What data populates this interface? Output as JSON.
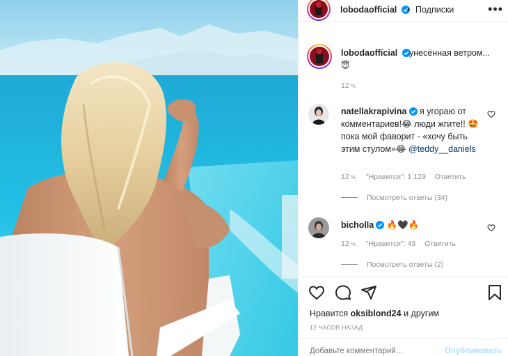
{
  "post": {
    "author": "lobodaofficial",
    "follow_label": "Подписки",
    "dot": "•",
    "more": "•••",
    "caption": "унесённая ветром...",
    "caption_emoji": "😇",
    "caption_time": "12 ч."
  },
  "comments": [
    {
      "user": "natellakrapivina",
      "text_before": "я угораю от комментариев!😂 люди жгите!! 🤩 пока мой фаворит - «хочу быть этим стулом»😂 ",
      "mention": "@teddy__daniels",
      "time": "12 ч.",
      "likes": "\"Нравится\": 1 129",
      "reply": "Ответить",
      "view_replies": "Посмотреть ответы (34)"
    },
    {
      "user": "bicholla",
      "text_before": "🔥🖤🔥",
      "mention": "",
      "time": "12 ч.",
      "likes": "\"Нравится\": 43",
      "reply": "Ответить",
      "view_replies": "Посмотреть ответы (2)"
    }
  ],
  "actions": {
    "likes_prefix": "Нравится",
    "likes_user": "oksiblond24",
    "likes_suffix": "и другим",
    "date": "12 ЧАСОВ НАЗАД",
    "add_comment_placeholder": "Добавьте комментарий...",
    "publish_label": "Опубликовать"
  },
  "colors": {
    "verified": "#0095f6",
    "link": "#00376b",
    "muted": "#8e8e8e"
  },
  "icons": [
    "more-icon",
    "verified-icon",
    "heart-icon",
    "comment-icon",
    "share-icon",
    "bookmark-icon"
  ]
}
